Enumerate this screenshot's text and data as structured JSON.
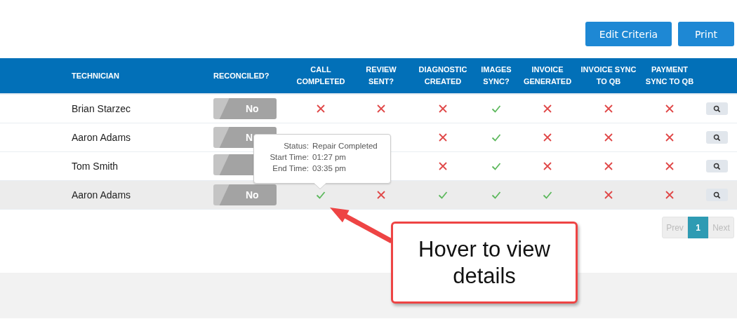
{
  "toolbar": {
    "buttons": [
      "Edit Criteria",
      "Print"
    ]
  },
  "table": {
    "columns": [
      "TECHNICIAN",
      "RECONCILED?",
      "CALL COMPLETED",
      "REVIEW SENT?",
      "DIAGNOSTIC CREATED",
      "IMAGES SYNC?",
      "INVOICE GENERATED",
      "INVOICE SYNC TO QB",
      "PAYMENT SYNC TO QB"
    ],
    "rows": [
      {
        "technician": "Brian Starzec",
        "reconciled": {
          "label": "No",
          "on": false
        },
        "call_completed": false,
        "review_sent": false,
        "diagnostic_created": false,
        "images_sync": true,
        "invoice_generated": false,
        "invoice_sync_to_qb": false,
        "payment_sync_to_qb": false,
        "hovered": false
      },
      {
        "technician": "Aaron Adams",
        "reconciled": {
          "label": "N",
          "on": false
        },
        "diagnostic_created": false,
        "images_sync": true,
        "invoice_generated": false,
        "invoice_sync_to_qb": false,
        "payment_sync_to_qb": false,
        "hovered": false
      },
      {
        "technician": "Tom Smith",
        "reconciled": {
          "on": false
        },
        "diagnostic_created": false,
        "images_sync": true,
        "invoice_generated": false,
        "invoice_sync_to_qb": false,
        "payment_sync_to_qb": false,
        "hovered": false
      },
      {
        "technician": "Aaron Adams",
        "reconciled": {
          "label": "No",
          "on": false
        },
        "call_completed": true,
        "review_sent": false,
        "diagnostic_created": true,
        "images_sync": true,
        "invoice_generated": true,
        "invoice_sync_to_qb": false,
        "payment_sync_to_qb": false,
        "hovered": true
      }
    ]
  },
  "tooltip": {
    "lines": [
      {
        "label": "Status:",
        "value": "Repair Completed"
      },
      {
        "label": "Start Time:",
        "value": "01:27 pm"
      },
      {
        "label": "End Time:",
        "value": "03:35 pm"
      }
    ]
  },
  "pagination": {
    "prev": "Prev",
    "pages": [
      {
        "label": "1",
        "selected": true
      }
    ],
    "next": "Next"
  },
  "callout": {
    "text": "Hover to view details"
  }
}
